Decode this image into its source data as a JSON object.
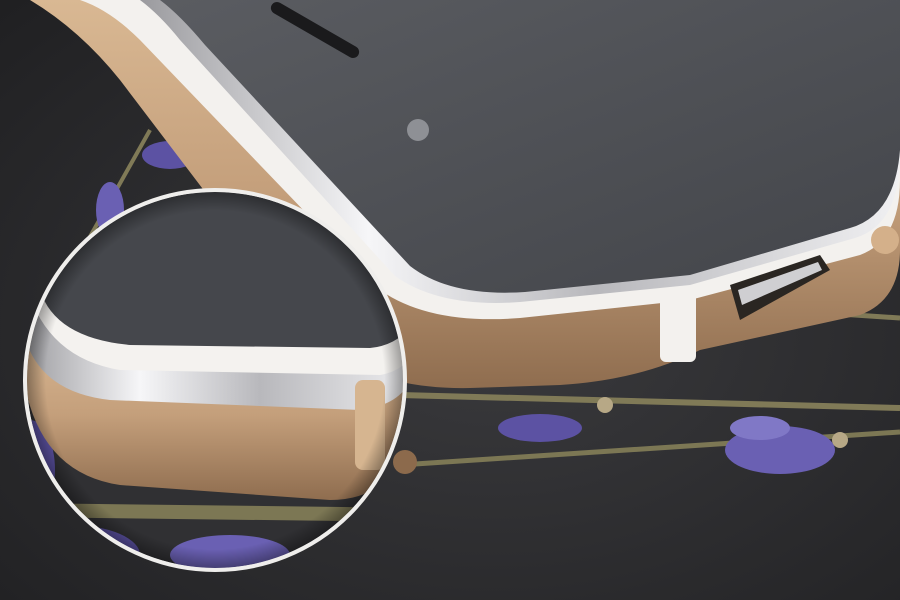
{
  "photo": {
    "subject": "",
    "colors": {
      "background": "#2b2b2d",
      "phone_gold": "#c9a47f",
      "phone_gold_dark": "#8c6a4c",
      "bumper_white": "#f4f2ef",
      "chrome": "#e8e8ea",
      "screen": "#4a4c50",
      "lavender": "#6b5fb0",
      "stem": "#7f7a55"
    }
  }
}
